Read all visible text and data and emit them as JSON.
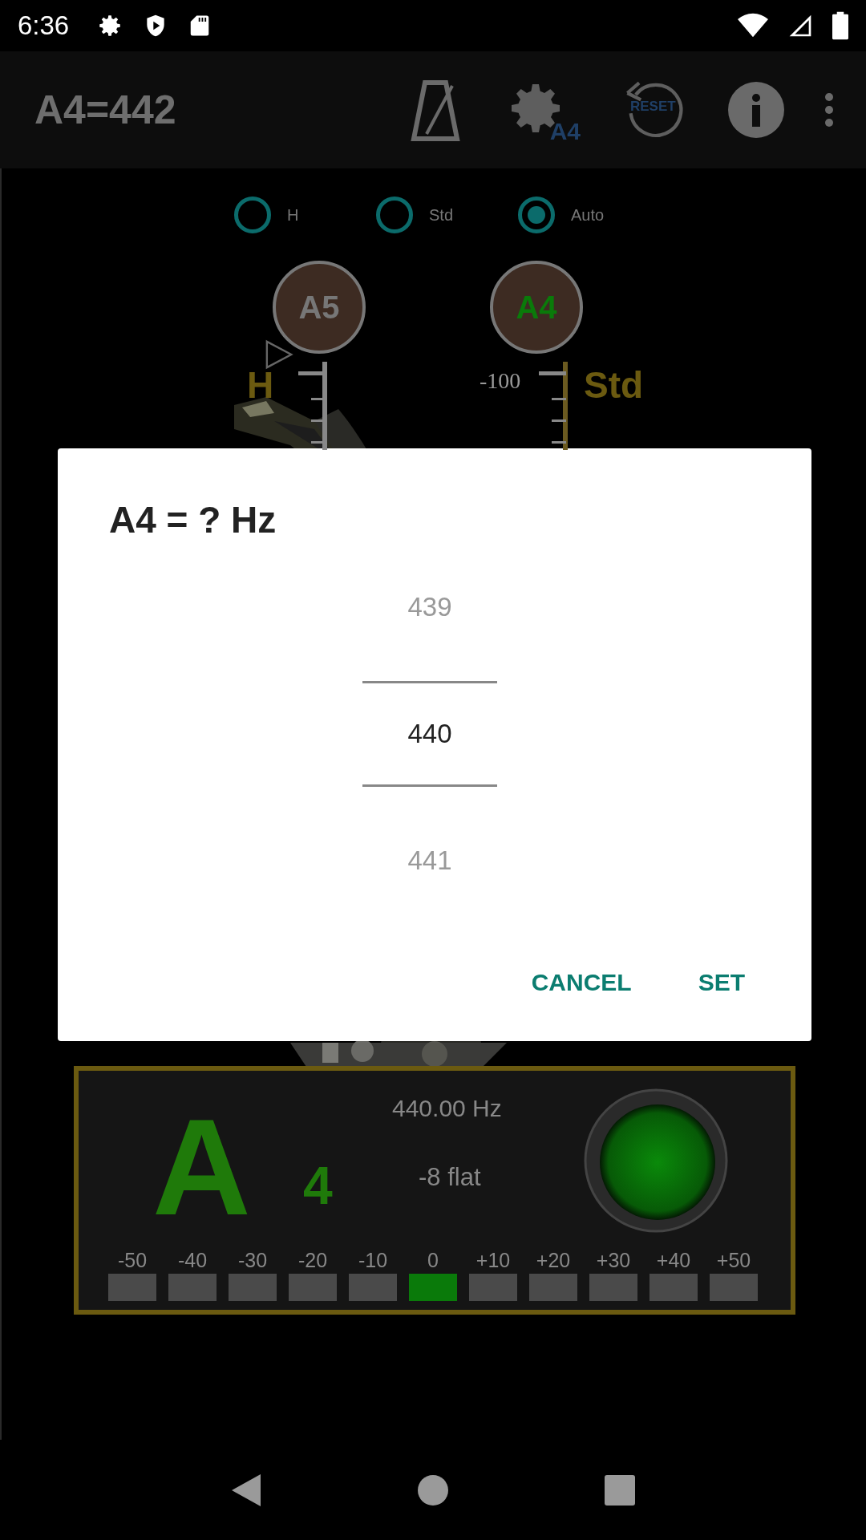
{
  "status_bar": {
    "time": "6:36"
  },
  "app_bar": {
    "title": "A4=442",
    "actions": [
      {
        "kind": "metronome"
      },
      {
        "kind": "settings",
        "label": "A4"
      },
      {
        "kind": "reset",
        "label": "RESET"
      },
      {
        "kind": "info"
      },
      {
        "kind": "overflow"
      }
    ]
  },
  "modes": [
    {
      "label": "H",
      "selected": false
    },
    {
      "label": "Std",
      "selected": false
    },
    {
      "label": "Auto",
      "selected": true
    }
  ],
  "notes": [
    {
      "label": "A5",
      "active": false
    },
    {
      "label": "A4",
      "active": true
    }
  ],
  "scales": [
    {
      "label": "H",
      "pointer": true
    },
    {
      "label": "Std",
      "pointer": false,
      "reading": "-100"
    }
  ],
  "dialog": {
    "title": "A4 = ? Hz",
    "picker": [
      {
        "value": "439",
        "selected": false
      },
      {
        "value": "440",
        "selected": true
      },
      {
        "value": "441",
        "selected": false
      }
    ],
    "buttons": [
      "CANCEL",
      "SET"
    ]
  },
  "tuner": {
    "note": "A",
    "octave": "4",
    "frequency": "440.00 Hz",
    "deviation": "-8 flat",
    "in_tune": true,
    "meter": [
      {
        "label": "-50",
        "selected": false
      },
      {
        "label": "-40",
        "selected": false
      },
      {
        "label": "-30",
        "selected": false
      },
      {
        "label": "-20",
        "selected": false
      },
      {
        "label": "-10",
        "selected": false
      },
      {
        "label": "0",
        "selected": true
      },
      {
        "label": "+10",
        "selected": false
      },
      {
        "label": "+20",
        "selected": false
      },
      {
        "label": "+30",
        "selected": false
      },
      {
        "label": "+40",
        "selected": false
      },
      {
        "label": "+50",
        "selected": false
      }
    ]
  }
}
